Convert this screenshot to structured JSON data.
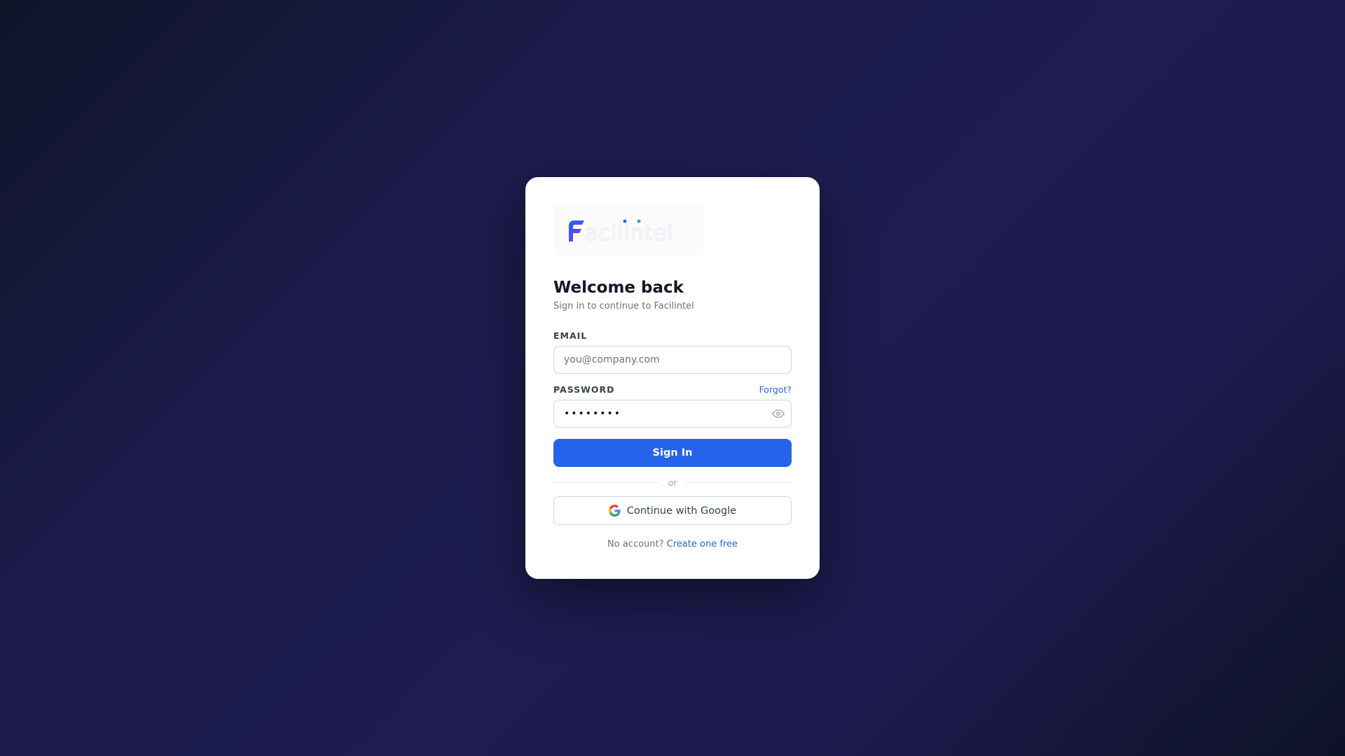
{
  "brand": {
    "logo_text": "Facilintel",
    "logo_gradient_start": "#2563eb",
    "logo_gradient_end": "#7c3aed",
    "logo_dot_colors": [
      "#2563eb",
      "#14b8a6"
    ]
  },
  "header": {
    "title": "Welcome back",
    "subtitle": "Sign in to continue to Facilintel"
  },
  "form": {
    "email_label": "EMAIL",
    "email_placeholder": "you@company.com",
    "email_value": "",
    "password_label": "PASSWORD",
    "forgot_label": "Forgot?",
    "password_value": "••••••••",
    "show_password_icon": "eye-icon",
    "submit_label": "Sign In"
  },
  "divider": {
    "label": "or"
  },
  "oauth": {
    "google_label": "Continue with Google",
    "google_icon": "google-icon"
  },
  "footer": {
    "prompt": "No account?",
    "link_label": "Create one free"
  },
  "colors": {
    "accent": "#2563eb",
    "card_bg": "#ffffff",
    "page_bg_dark": "#0f1429",
    "page_bg_mid": "#1e1c50"
  }
}
